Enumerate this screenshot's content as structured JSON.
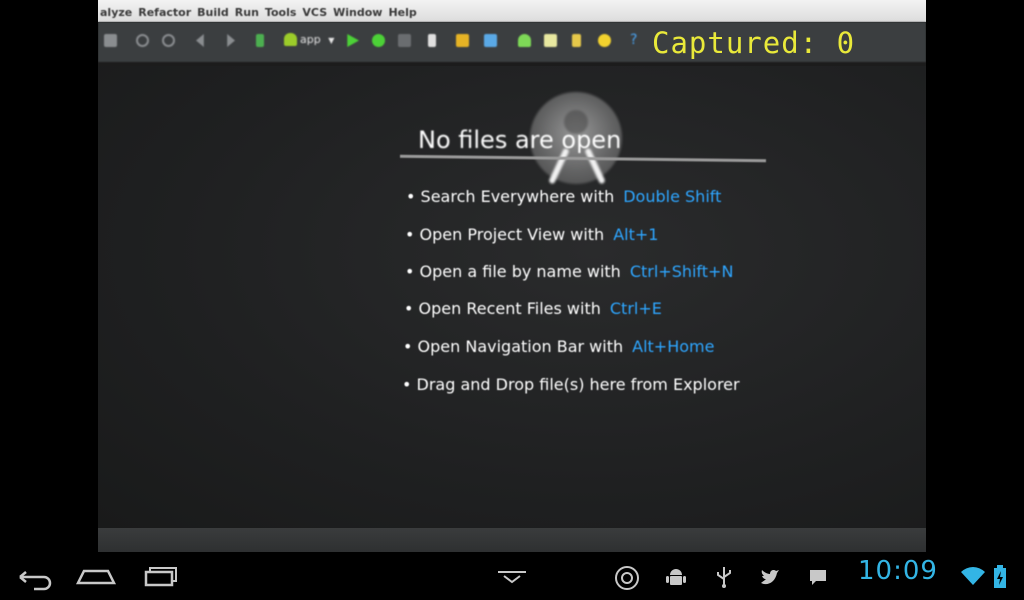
{
  "ide": {
    "menu_items": [
      "alyze",
      "Refactor",
      "Build",
      "Run",
      "Tools",
      "VCS",
      "Window",
      "Help"
    ],
    "run_config": "app"
  },
  "overlay": {
    "captured_text": "Captured: 0",
    "color": "#e9e93a"
  },
  "editor": {
    "title": "No files are open",
    "hints": [
      {
        "desc": "Search Everywhere with",
        "key": "Double Shift"
      },
      {
        "desc": "Open Project View with",
        "key": "Alt+1"
      },
      {
        "desc": "Open a file by name with",
        "key": "Ctrl+Shift+N"
      },
      {
        "desc": "Open Recent Files with",
        "key": "Ctrl+E"
      },
      {
        "desc": "Open Navigation Bar with",
        "key": "Alt+Home"
      },
      {
        "desc": "Drag and Drop file(s) here from Explorer",
        "key": ""
      }
    ],
    "key_color": "#2ea6ff"
  },
  "system_bar": {
    "time": "10:09",
    "accent": "#33b5e5",
    "nav_icons": [
      "back-icon",
      "home-icon",
      "recent-apps-icon"
    ],
    "notification_icons": [
      "camera-app-icon",
      "android-debug-icon",
      "usb-icon",
      "twitter-icon",
      "message-icon"
    ],
    "status_icons": [
      "wifi-icon",
      "battery-icon"
    ]
  }
}
